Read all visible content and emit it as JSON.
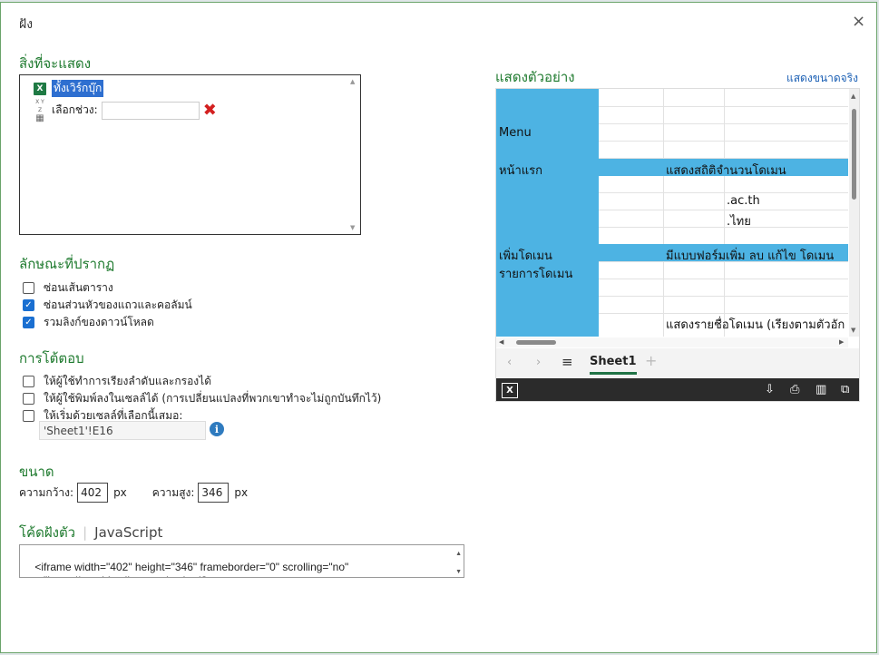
{
  "dialog": {
    "title": "ฝัง",
    "close_glyph": "×"
  },
  "what_to_show": {
    "heading": "สิ่งที่จะแสดง",
    "workbook_label": "ทั้งเวิร์กบุ๊ก",
    "range_icon_text": "X Y Z",
    "range_label": "เลือกช่วง:",
    "range_value": ""
  },
  "appearance": {
    "heading": "ลักษณะที่ปรากฏ",
    "options": [
      {
        "label": "ซ่อนเส้นตาราง",
        "checked": false
      },
      {
        "label": "ซ่อนส่วนหัวของแถวและคอลัมน์",
        "checked": true
      },
      {
        "label": "รวมลิงก์ของดาวน์โหลด",
        "checked": true
      }
    ]
  },
  "interaction": {
    "heading": "การโต้ตอบ",
    "options": [
      {
        "label": "ให้ผู้ใช้ทำการเรียงลำดับและกรองได้",
        "checked": false
      },
      {
        "label": "ให้ผู้ใช้พิมพ์ลงในเซลล์ได้ (การเปลี่ยนแปลงที่พวกเขาทำจะไม่ถูกบันทึกไว้)",
        "checked": false
      },
      {
        "label": "ให้เริ่มด้วยเซลล์ที่เลือกนี้เสมอ:",
        "checked": false
      }
    ],
    "start_cell_value": "'Sheet1'!E16",
    "info_glyph": "i"
  },
  "size": {
    "heading": "ขนาด",
    "width_label": "ความกว้าง:",
    "width_value": "402",
    "height_label": "ความสูง:",
    "height_value": "346",
    "unit": "px"
  },
  "embed_code": {
    "tab_active": "โค้ดฝังตัว",
    "tab_js": "JavaScript",
    "code": "<iframe width=\"402\" height=\"346\" frameborder=\"0\" scrolling=\"no\"\nsrc=\"https://onedrive.live.com/embed?"
  },
  "preview": {
    "heading": "แสดงตัวอย่าง",
    "actual_size_link": "แสดงขนาดจริง",
    "cells": {
      "menu": "Menu",
      "home": "หน้าแรก",
      "stats": "แสดงสถิติจำนวนโดเมน",
      "ac_th": ".ac.th",
      "thai": ".ไทย",
      "add_domain": "เพิ่มโดเมน",
      "form": "มีแบบฟอร์มเพิ่ม ลบ แก้ไข โดเมน",
      "domain_list": "รายการโดเมน",
      "list_desc": "แสดงรายชื่อโดเมน (เรียงตามตัวอัก"
    },
    "sheet_tab": "Sheet1",
    "nav_prev": "‹",
    "nav_next": "›",
    "menu_glyph": "≡",
    "add_sheet_glyph": "+",
    "status_icons": [
      "excel-icon",
      "download-icon",
      "print-icon",
      "reading-view-icon",
      "popout-icon"
    ],
    "colors": {
      "accent_green": "#1e7a2e",
      "cell_blue": "#4db3e3",
      "status_bar": "#2b2b2b"
    }
  }
}
